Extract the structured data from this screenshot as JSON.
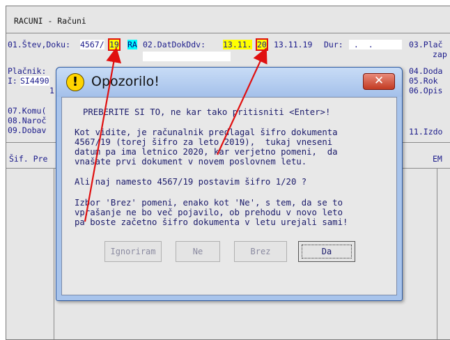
{
  "window": {
    "title": "RACUNI - Računi"
  },
  "form": {
    "f01_label": "01.Štev,Doku:",
    "f01_value_a": "4567/",
    "f01_value_b": "19",
    "f01_badge": "RA",
    "f02_label": "02.DatDokDdv:",
    "f02_value_a": "13.11.",
    "f02_value_b": "20",
    "f02_value_c": "13.11.19",
    "dur_label": "Dur:",
    "dur_value": " .  .",
    "r03": "03.Plač",
    "r03b": "zap",
    "r04": "04.Doda",
    "r05": "05.Rok",
    "r06": "06.Opis",
    "placnik": "Plačnik:",
    "i_label": "I:",
    "i_value": "SI4490",
    "i_line2": "1",
    "r07": "07.Komu(",
    "r08": "08.Naroč",
    "r09": "09.Dobav",
    "r11": "11.Izdo",
    "col_sif": "Šif. Pre",
    "col_em": "EM"
  },
  "dialog": {
    "title": "Opozorilo!",
    "close_glyph": "✕",
    "lines": [
      "PREBERITE SI TO, ne kar tako pritisniti <Enter>!",
      "Kot vidite, je računalnik predlagal šifro dokumenta",
      "4567/19 (torej šifro za leto 2019),  tukaj vneseni",
      "datum pa ima letnico 2020, kar verjetno pomeni,  da",
      "vnašate prvi dokument v novem poslovnem letu.",
      "Ali naj namesto 4567/19 postavim šifro 1/20 ?",
      "Izbor 'Brez' pomeni, enako kot 'Ne', s tem, da se to",
      "vprašanje ne bo več pojavilo, ob prehodu v novo leto",
      "pa boste začetno šifro dokumenta v letu urejali sami!"
    ],
    "buttons": {
      "ignore": "Ignoriram",
      "no": "Ne",
      "none": "Brez",
      "yes": "Da"
    }
  },
  "colors": {
    "annotation": "#e01010",
    "highlight": "#ffff00",
    "badge": "#00ffff"
  }
}
